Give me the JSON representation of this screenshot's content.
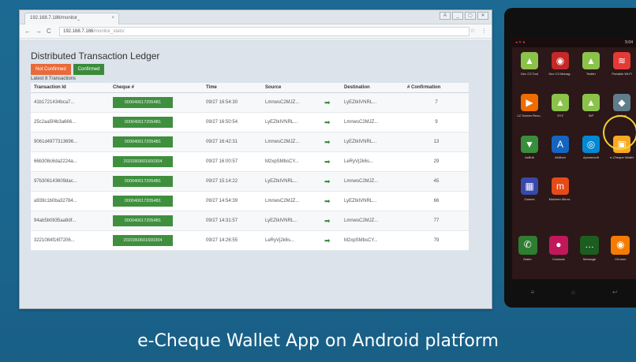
{
  "browser": {
    "tab_title": "192.168.7.186/monitor_",
    "tab_close": "×",
    "win_buttons": [
      "A",
      "_",
      "▢",
      "✕"
    ],
    "url_host": "192.168.7.186",
    "url_path": "/monitor_stats/",
    "back_icon": "←",
    "forward_icon": "→",
    "reload_icon": "C"
  },
  "page": {
    "title": "Distributed Transaction Ledger",
    "btn_not_confirmed": "Not Confirmed",
    "btn_confirmed": "Confirmed",
    "latest": "Latest 8 Transactions"
  },
  "table": {
    "headers": [
      "Transaction Id",
      "Cheque #",
      "Time",
      "Source",
      "",
      "Destination",
      "# Confirmation"
    ],
    "rows": [
      {
        "txid": "41b1721434bca7...",
        "cheque": "0000406172054B1",
        "time": "09/27 16:54:30",
        "source": "LmnwsC2MJZ...",
        "dest": "LyEZtkIVNRL...",
        "conf": "7"
      },
      {
        "txid": "25c2aa5f4b3a666...",
        "cheque": "0000406172054B1",
        "time": "09/27 16:50:54",
        "source": "LyEZtkIVNRL...",
        "dest": "LmnwsC2MJZ...",
        "conf": "9"
      },
      {
        "txid": "9061d4977313696...",
        "cheque": "0000406172054B1",
        "time": "09/27 16:42:31",
        "source": "LmnwsC2MJZ...",
        "dest": "LyEZtkIVNRL...",
        "conf": "13"
      },
      {
        "txid": "66b308c6da2224a...",
        "cheque": "2020360601600304",
        "time": "09/27 16:00:57",
        "source": "M2xpSMbsCY...",
        "dest": "LeRyVj2k6s...",
        "conf": "29"
      },
      {
        "txid": "97b306143609dac...",
        "cheque": "0000406172054B1",
        "time": "09/27 15:14:22",
        "source": "LyEZtkIVNRL...",
        "dest": "LmnwsC2MJZ...",
        "conf": "45"
      },
      {
        "txid": "a939c1b0ba32784...",
        "cheque": "0000406172054B1",
        "time": "09/27 14:54:39",
        "source": "LmnwsC2MJZ...",
        "dest": "LyEZtkIVNRL...",
        "conf": "66"
      },
      {
        "txid": "94ab5b0835aa9df...",
        "cheque": "0000406172054B1",
        "time": "09/27 14:31:57",
        "source": "LyEZtkIVNRL...",
        "dest": "LmnwsC2MJZ...",
        "conf": "77"
      },
      {
        "txid": "3221084f16f7206...",
        "cheque": "2020360601600304",
        "time": "09/27 14:26:55",
        "source": "LeRyVj2k6s...",
        "dest": "M2xpSMbsCY...",
        "conf": "79"
      }
    ]
  },
  "phone": {
    "status_right": "5:04",
    "apps": [
      {
        "label": "Dev C3 Tool",
        "icon": "android-icon",
        "glyph": "▲",
        "color": "#8bc34a"
      },
      {
        "label": "Dev C3 Manag..",
        "icon": "dev-manager-icon",
        "glyph": "◉",
        "color": "#c62828"
      },
      {
        "label": "Testbrr",
        "icon": "android-icon",
        "glyph": "▲",
        "color": "#8bc34a"
      },
      {
        "label": "Portable Wi-Fi",
        "icon": "wifi-icon",
        "glyph": "≋",
        "color": "#e53935"
      },
      {
        "label": "LZ Screen Reco..",
        "icon": "video-record-icon",
        "glyph": "▶",
        "color": "#ef6c00"
      },
      {
        "label": "SYZ",
        "icon": "android-icon",
        "glyph": "▲",
        "color": "#8bc34a"
      },
      {
        "label": "SIP",
        "icon": "android-icon",
        "glyph": "▲",
        "color": "#8bc34a"
      },
      {
        "label": "Unlock",
        "icon": "unlock-icon",
        "glyph": "◆",
        "color": "#607d8b"
      },
      {
        "label": "AsBrid",
        "icon": "asbrid-icon",
        "glyph": "▼",
        "color": "#388e3c"
      },
      {
        "label": "AirMore",
        "icon": "airmore-icon",
        "glyph": "A",
        "color": "#1565c0"
      },
      {
        "label": "Apowersoft",
        "icon": "apowersoft-icon",
        "glyph": "◎",
        "color": "#0288d1"
      },
      {
        "label": "e-Cheque Wallet",
        "icon": "wallet-icon",
        "glyph": "▣",
        "color": "#f9a825"
      },
      {
        "label": "Games",
        "icon": "games-icon",
        "glyph": "▦",
        "color": "#3949ab"
      },
      {
        "label": "Mobizen Mirror..",
        "icon": "mobizen-icon",
        "glyph": "m",
        "color": "#e64a19"
      }
    ],
    "dock": [
      {
        "label": "Dialer",
        "icon": "phone-icon",
        "glyph": "✆",
        "color": "#2e7d32"
      },
      {
        "label": "Contacts",
        "icon": "contacts-icon",
        "glyph": "●",
        "color": "#c2185b"
      },
      {
        "label": "Message",
        "icon": "message-icon",
        "glyph": "…",
        "color": "#1b5e20"
      },
      {
        "label": "Chrome",
        "icon": "chrome-icon",
        "glyph": "◉",
        "color": "#f57c00"
      }
    ],
    "nav": [
      "≡",
      "⌂",
      "↩"
    ]
  },
  "caption": "e-Cheque Wallet App on Android platform"
}
